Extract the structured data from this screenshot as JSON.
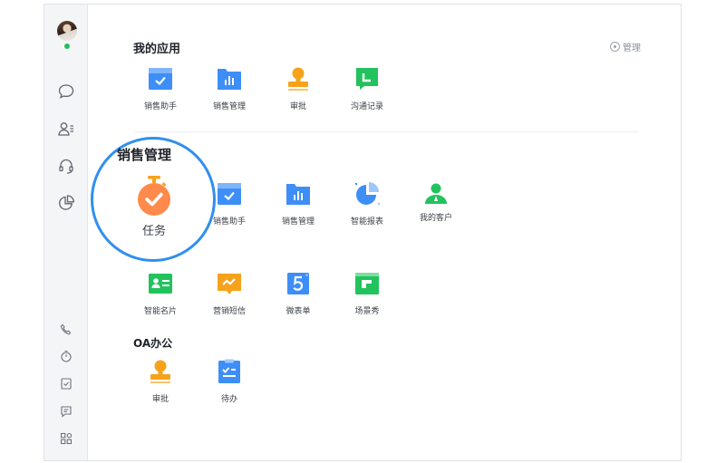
{
  "sidebar": {
    "nav_icons": [
      "chat-icon",
      "contacts-icon",
      "headset-icon",
      "pie-chart-icon"
    ],
    "bottom_icons": [
      "phone-icon",
      "timer-icon",
      "checklist-icon",
      "notes-icon",
      "apps-grid-icon"
    ]
  },
  "sections": {
    "my_apps": {
      "title": "我的应用",
      "manage_label": "管理",
      "apps": [
        {
          "label": "销售助手",
          "icon": "sales-assistant-icon",
          "color": "#3e8ef7"
        },
        {
          "label": "销售管理",
          "icon": "sales-management-icon",
          "color": "#3e8ef7"
        },
        {
          "label": "审批",
          "icon": "approval-stamp-icon",
          "color": "#f7a21b"
        },
        {
          "label": "沟通记录",
          "icon": "communication-record-icon",
          "color": "#22c35e"
        }
      ]
    },
    "sales_mgmt": {
      "title": "销售管理",
      "apps": [
        {
          "label": "销售助手",
          "icon": "sales-assistant-icon",
          "color": "#3e8ef7"
        },
        {
          "label": "销售管理",
          "icon": "sales-management-icon",
          "color": "#3e8ef7"
        },
        {
          "label": "智能报表",
          "icon": "smart-report-icon",
          "color": "#3e8ef7"
        },
        {
          "label": "我的客户",
          "icon": "my-customers-icon",
          "color": "#22c35e"
        },
        {
          "label": "智能名片",
          "icon": "smart-card-icon",
          "color": "#22c35e"
        },
        {
          "label": "营销短信",
          "icon": "marketing-sms-icon",
          "color": "#f7a21b"
        },
        {
          "label": "微表单",
          "icon": "micro-form-icon",
          "color": "#3e8ef7"
        },
        {
          "label": "场景秀",
          "icon": "scene-show-icon",
          "color": "#22c35e"
        }
      ]
    },
    "oa": {
      "title": "OA办公",
      "apps": [
        {
          "label": "审批",
          "icon": "approval-stamp-icon",
          "color": "#f7a21b"
        },
        {
          "label": "待办",
          "icon": "todo-icon",
          "color": "#3e8ef7"
        }
      ]
    }
  },
  "highlight": {
    "title": "销售管理",
    "app_label": "任务",
    "icon": "task-stopwatch-icon",
    "ring_color": "#2f8ff0",
    "icon_color": "#ff8a4c"
  }
}
